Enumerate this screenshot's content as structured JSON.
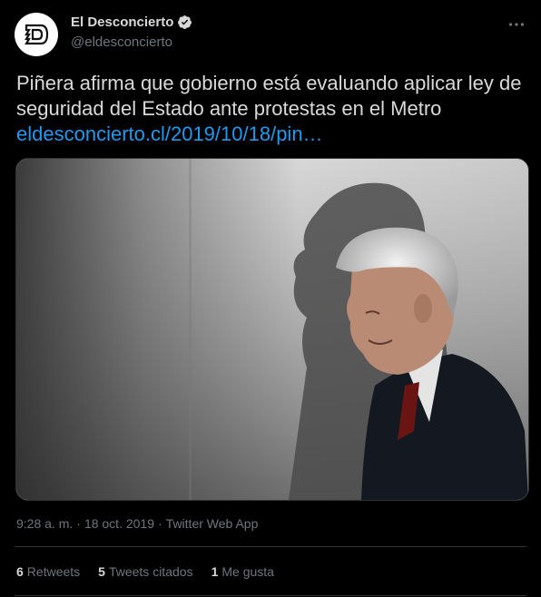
{
  "account": {
    "name": "El Desconcierto",
    "handle": "@eldesconcierto",
    "verified": true,
    "avatar_icon": "el-desconcierto-logo-icon"
  },
  "tweet": {
    "text": "Piñera afirma que gobierno está evaluando aplicar ley de seguridad del Estado ante protestas en el Metro",
    "link_text": "eldesconcierto.cl/2019/10/18/pin…",
    "image_description": "photo-of-man-in-suit-with-shadow-on-wall",
    "time": "9:28 a. m.",
    "date": "18 oct. 2019",
    "app": "Twitter Web App"
  },
  "stats": {
    "retweets_count": "6",
    "retweets_label": "Retweets",
    "quotes_count": "5",
    "quotes_label": "Tweets citados",
    "likes_count": "1",
    "likes_label": "Me gusta"
  },
  "colors": {
    "background": "#000000",
    "text": "#d9d9d9",
    "secondary": "#6e767d",
    "link": "#1d9bf0",
    "divider": "#2f3336"
  }
}
